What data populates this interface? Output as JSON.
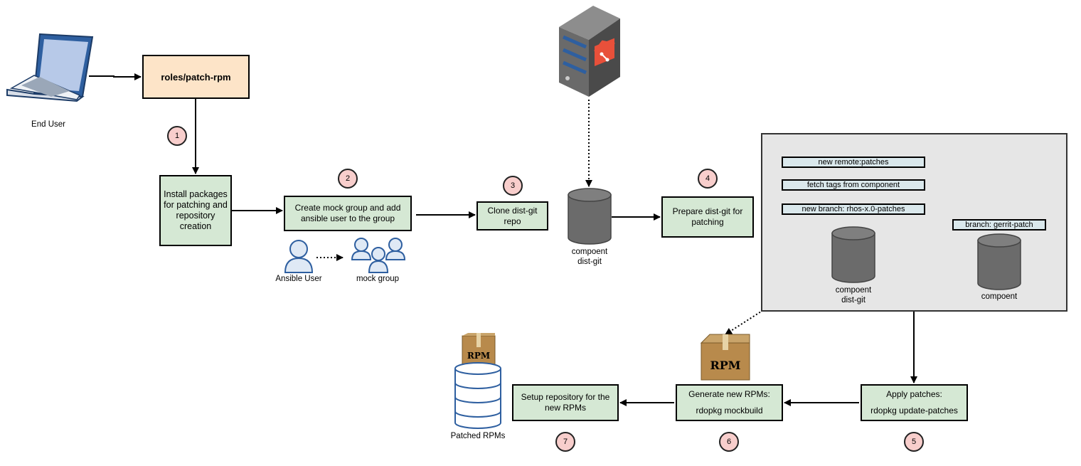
{
  "end_user": {
    "label": "End User"
  },
  "role": {
    "label": "roles/patch-rpm"
  },
  "steps": [
    {
      "number": "1",
      "label": "Install packages for patching and repository creation"
    },
    {
      "number": "2",
      "label": "Create mock group and add ansible user to the group"
    },
    {
      "number": "3",
      "label": "Clone dist-git repo"
    },
    {
      "number": "4",
      "label": "Prepare dist-git for patching"
    },
    {
      "number": "5",
      "label": "Apply patches:",
      "command": "rdopkg update-patches"
    },
    {
      "number": "6",
      "label": "Generate new RPMs:",
      "command": "rdopkg mockbuild"
    },
    {
      "number": "7",
      "label": "Setup repository for the new RPMs"
    }
  ],
  "users": {
    "ansible_user": "Ansible User",
    "mock_group": "mock group"
  },
  "dist_git": {
    "label_line1": "compoent",
    "label_line2": "dist-git"
  },
  "panel": {
    "tags": {
      "new_remote": "new remote:patches",
      "fetch_tags": "fetch tags from component",
      "new_branch": "new branch: rhos-x.0-patches",
      "gerrit_branch": "branch: gerrit-patch"
    },
    "inner_dist_git": {
      "label_line1": "compoent",
      "label_line2": "dist-git"
    },
    "component": {
      "label": "compoent"
    }
  },
  "rpm_package": {
    "label": "RPM"
  },
  "patched_rpms": {
    "label": "Patched RPMs",
    "rpm_label": "RPM"
  },
  "colors": {
    "step_fill": "#d5e8d4",
    "role_fill": "#fde4c8",
    "badge_fill": "#f8cecc",
    "tag_fill": "#dae8ec",
    "panel_fill": "#e6e6e6",
    "git_orange": "#e8503a",
    "db_gray": "#6b6b6b"
  }
}
